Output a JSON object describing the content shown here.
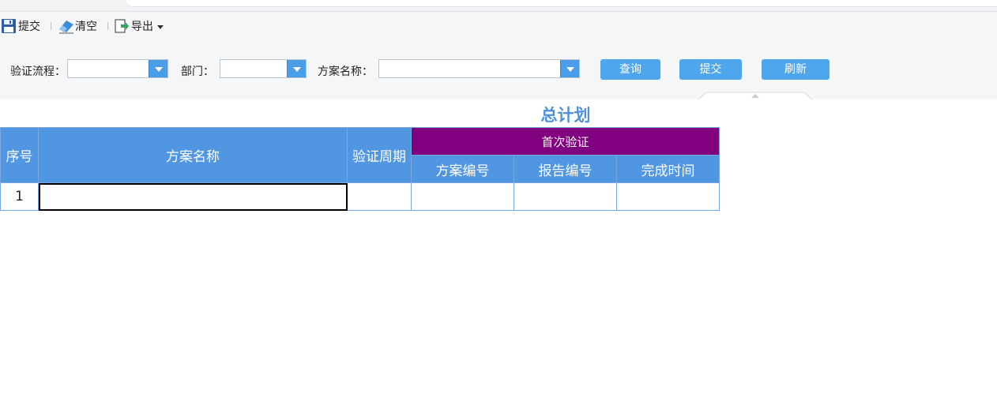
{
  "toolbar": {
    "submit_label": "提交",
    "clear_label": "清空",
    "export_label": "导出"
  },
  "filters": {
    "flow_label": "验证流程：",
    "flow_value": "",
    "dept_label": "部门：",
    "dept_value": "",
    "plan_name_label": "方案名称：",
    "plan_name_value": ""
  },
  "buttons": {
    "query": "查询",
    "submit": "提交",
    "refresh": "刷新"
  },
  "report": {
    "title": "总计划",
    "headers": {
      "seq": "序号",
      "plan_name": "方案名称",
      "cycle": "验证周期",
      "first_verify": "首次验证",
      "plan_no": "方案编号",
      "report_no": "报告编号",
      "finish_time": "完成时间"
    },
    "rows": [
      {
        "seq": "1",
        "plan_name": "",
        "cycle": "",
        "plan_no": "",
        "report_no": "",
        "finish_time": ""
      }
    ]
  },
  "colors": {
    "header_blue": "#5196e1",
    "header_purple": "#800080",
    "button_blue": "#4ea7ec",
    "title_blue": "#4f91d8"
  }
}
